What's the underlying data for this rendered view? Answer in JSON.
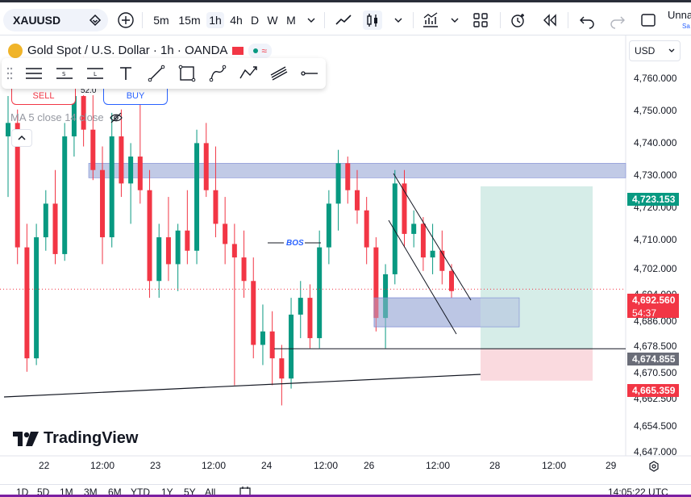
{
  "toolbar": {
    "symbol": "XAUUSD",
    "intervals": [
      "5m",
      "15m",
      "1h",
      "4h",
      "D",
      "W",
      "M"
    ],
    "active_interval": "1h",
    "user_label": "Unna",
    "user_sub": "Sa"
  },
  "legend": {
    "title": "Gold Spot / U.S. Dollar · 1h · OANDA",
    "sell_label": "SELL",
    "buy_label": "BUY",
    "spread": "52.0",
    "ma_label": "MA 5 close 14 close"
  },
  "currency_select": "USD",
  "price_axis": {
    "ticks": [
      "4,760.000",
      "4,750.000",
      "4,740.000",
      "4,730.000",
      "4,720.000",
      "4,710.000",
      "4,702.000",
      "4,694.000",
      "4,686.000",
      "4,678.500",
      "4,670.500",
      "4,662.500",
      "4,654.500",
      "4,647.000"
    ],
    "labels": {
      "take_profit": "4,723.153",
      "current_price": "4,692.560",
      "countdown": "54:37",
      "level": "4,674.855",
      "stop_loss": "4,665.359"
    }
  },
  "time_axis": [
    "22",
    "12:00",
    "23",
    "12:00",
    "24",
    "12:00",
    "26",
    "12:00",
    "28",
    "12:00",
    "29"
  ],
  "annotations": {
    "bos": "BOS"
  },
  "branding": "TradingView",
  "bottom_bar": {
    "ranges": [
      "1D",
      "5D",
      "1M",
      "3M",
      "6M",
      "YTD",
      "1Y",
      "5Y",
      "All"
    ],
    "clock": "14:05:22 UTC"
  },
  "colors": {
    "up": "#089981",
    "down": "#f23645",
    "zone": "#b2bde0",
    "profit_zone": "#cfeae4",
    "loss_zone": "#fad6dc"
  },
  "chart_data": {
    "type": "candlestick",
    "symbol": "XAUUSD",
    "interval": "1h",
    "ylim": [
      4643,
      4768
    ],
    "x": [
      "22",
      "12:00",
      "23",
      "12:00",
      "24",
      "12:00",
      "26",
      "12:00",
      "28",
      "12:00",
      "29"
    ],
    "candles": [
      [
        4738,
        4750,
        4720,
        4742
      ],
      [
        4742,
        4746,
        4700,
        4705
      ],
      [
        4705,
        4712,
        4668,
        4672
      ],
      [
        4672,
        4712,
        4670,
        4708
      ],
      [
        4708,
        4722,
        4704,
        4718
      ],
      [
        4718,
        4728,
        4700,
        4703
      ],
      [
        4703,
        4742,
        4701,
        4738
      ],
      [
        4738,
        4758,
        4732,
        4750
      ],
      [
        4750,
        4762,
        4735,
        4740
      ],
      [
        4740,
        4755,
        4725,
        4728
      ],
      [
        4728,
        4735,
        4700,
        4708
      ],
      [
        4708,
        4745,
        4705,
        4738
      ],
      [
        4738,
        4746,
        4720,
        4724
      ],
      [
        4724,
        4736,
        4712,
        4732
      ],
      [
        4732,
        4748,
        4718,
        4722
      ],
      [
        4722,
        4728,
        4690,
        4695
      ],
      [
        4695,
        4712,
        4690,
        4708
      ],
      [
        4708,
        4720,
        4695,
        4700
      ],
      [
        4700,
        4712,
        4692,
        4710
      ],
      [
        4710,
        4722,
        4700,
        4704
      ],
      [
        4704,
        4740,
        4700,
        4736
      ],
      [
        4736,
        4742,
        4720,
        4722
      ],
      [
        4722,
        4735,
        4708,
        4712
      ],
      [
        4712,
        4720,
        4700,
        4706
      ],
      [
        4706,
        4712,
        4664,
        4702
      ],
      [
        4702,
        4710,
        4690,
        4695
      ],
      [
        4695,
        4702,
        4672,
        4676
      ],
      [
        4676,
        4688,
        4670,
        4680
      ],
      [
        4680,
        4686,
        4664,
        4672
      ],
      [
        4672,
        4676,
        4658,
        4666
      ],
      [
        4666,
        4690,
        4663,
        4685
      ],
      [
        4685,
        4695,
        4678,
        4690
      ],
      [
        4690,
        4694,
        4675,
        4678
      ],
      [
        4678,
        4710,
        4675,
        4705
      ],
      [
        4705,
        4722,
        4700,
        4718
      ],
      [
        4718,
        4734,
        4710,
        4730
      ],
      [
        4730,
        4732,
        4718,
        4722
      ],
      [
        4722,
        4728,
        4712,
        4716
      ],
      [
        4716,
        4720,
        4700,
        4705
      ],
      [
        4705,
        4708,
        4680,
        4684
      ],
      [
        4684,
        4700,
        4675,
        4697
      ],
      [
        4697,
        4728,
        4694,
        4724
      ],
      [
        4724,
        4728,
        4705,
        4709
      ],
      [
        4709,
        4716,
        4705,
        4712
      ],
      [
        4712,
        4714,
        4698,
        4702
      ],
      [
        4702,
        4712,
        4697,
        4704
      ],
      [
        4704,
        4710,
        4694,
        4698
      ],
      [
        4698,
        4700,
        4690,
        4692
      ]
    ],
    "zones": [
      {
        "name": "supply",
        "from": 4726,
        "to": 4730
      },
      {
        "name": "demand",
        "from": 4684,
        "to": 4690
      }
    ],
    "position": {
      "entry": 4674.855,
      "take_profit": 4723.153,
      "stop_loss": 4665.359
    },
    "current_price": 4692.56
  }
}
